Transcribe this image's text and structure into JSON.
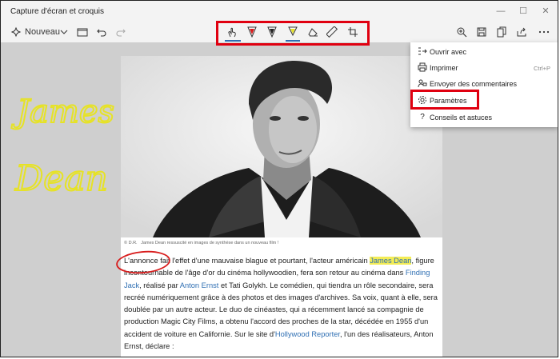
{
  "window": {
    "title": "Capture d'écran et croquis",
    "minimize": "—",
    "maximize": "☐",
    "close": "✕"
  },
  "toolbar": {
    "new_label": "Nouveau"
  },
  "menu": {
    "items": [
      {
        "label": "Ouvrir avec"
      },
      {
        "label": "Imprimer",
        "shortcut": "Ctrl+P"
      },
      {
        "label": "Envoyer des commentaires"
      },
      {
        "label": "Paramètres"
      },
      {
        "label": "Conseils et astuces"
      }
    ]
  },
  "article": {
    "caption_credit": "© D.R.",
    "caption": "James Dean ressuscité en images de synthèse dans un nouveau film !",
    "p1": "L'annonce",
    "p2": " fait l'effet d'une mauvaise blague et pourtant, l'acteur américain ",
    "p3": "James Dean",
    "p4": ", figure incontournable de l'âge d'or du cinéma hollywoodien, fera son retour au cinéma dans ",
    "link1": "Finding Jack",
    "p5": ", réalisé par ",
    "link2": "Anton Ernst",
    "p6": " et Tati Golykh. Le comédien, qui tiendra un rôle secondaire, sera recréé numériquement grâce à des photos et des images d'archives. Sa voix, quant à elle, sera doublée par un autre acteur. Le duo de cinéastes, qui a récemment lancé sa compagnie de production Magic City Films, a obtenu l'accord des proches de la star, décédée en 1955 d'un accident de voiture en Californie. Sur le site d'",
    "link3": "Hollywood Reporter",
    "p7": ", l'un des réalisateurs, Anton Ernst, déclare :"
  },
  "annotations": {
    "handwriting_1": "James",
    "handwriting_2": "Dean"
  },
  "colors": {
    "highlight": "#f3ec55",
    "annotation_red": "#e00010",
    "ink_yellow": "#e6e227",
    "ink_red": "#d81b1b",
    "accent_blue": "#2f6fb3"
  }
}
